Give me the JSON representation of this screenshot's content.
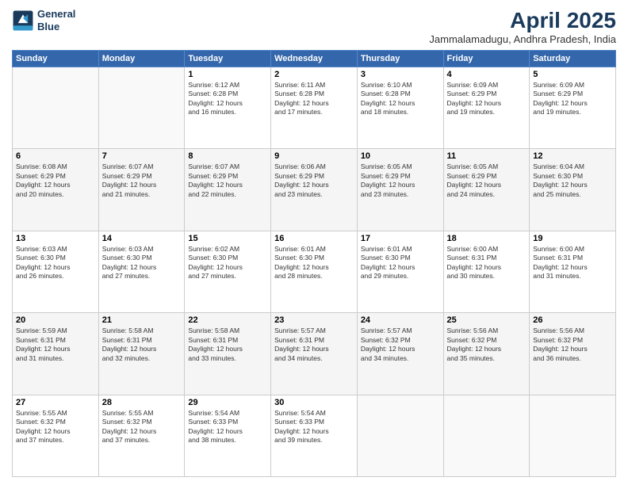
{
  "header": {
    "logo_line1": "General",
    "logo_line2": "Blue",
    "title": "April 2025",
    "subtitle": "Jammalamadugu, Andhra Pradesh, India"
  },
  "weekdays": [
    "Sunday",
    "Monday",
    "Tuesday",
    "Wednesday",
    "Thursday",
    "Friday",
    "Saturday"
  ],
  "weeks": [
    [
      {
        "day": "",
        "info": ""
      },
      {
        "day": "",
        "info": ""
      },
      {
        "day": "1",
        "info": "Sunrise: 6:12 AM\nSunset: 6:28 PM\nDaylight: 12 hours\nand 16 minutes."
      },
      {
        "day": "2",
        "info": "Sunrise: 6:11 AM\nSunset: 6:28 PM\nDaylight: 12 hours\nand 17 minutes."
      },
      {
        "day": "3",
        "info": "Sunrise: 6:10 AM\nSunset: 6:28 PM\nDaylight: 12 hours\nand 18 minutes."
      },
      {
        "day": "4",
        "info": "Sunrise: 6:09 AM\nSunset: 6:29 PM\nDaylight: 12 hours\nand 19 minutes."
      },
      {
        "day": "5",
        "info": "Sunrise: 6:09 AM\nSunset: 6:29 PM\nDaylight: 12 hours\nand 19 minutes."
      }
    ],
    [
      {
        "day": "6",
        "info": "Sunrise: 6:08 AM\nSunset: 6:29 PM\nDaylight: 12 hours\nand 20 minutes."
      },
      {
        "day": "7",
        "info": "Sunrise: 6:07 AM\nSunset: 6:29 PM\nDaylight: 12 hours\nand 21 minutes."
      },
      {
        "day": "8",
        "info": "Sunrise: 6:07 AM\nSunset: 6:29 PM\nDaylight: 12 hours\nand 22 minutes."
      },
      {
        "day": "9",
        "info": "Sunrise: 6:06 AM\nSunset: 6:29 PM\nDaylight: 12 hours\nand 23 minutes."
      },
      {
        "day": "10",
        "info": "Sunrise: 6:05 AM\nSunset: 6:29 PM\nDaylight: 12 hours\nand 23 minutes."
      },
      {
        "day": "11",
        "info": "Sunrise: 6:05 AM\nSunset: 6:29 PM\nDaylight: 12 hours\nand 24 minutes."
      },
      {
        "day": "12",
        "info": "Sunrise: 6:04 AM\nSunset: 6:30 PM\nDaylight: 12 hours\nand 25 minutes."
      }
    ],
    [
      {
        "day": "13",
        "info": "Sunrise: 6:03 AM\nSunset: 6:30 PM\nDaylight: 12 hours\nand 26 minutes."
      },
      {
        "day": "14",
        "info": "Sunrise: 6:03 AM\nSunset: 6:30 PM\nDaylight: 12 hours\nand 27 minutes."
      },
      {
        "day": "15",
        "info": "Sunrise: 6:02 AM\nSunset: 6:30 PM\nDaylight: 12 hours\nand 27 minutes."
      },
      {
        "day": "16",
        "info": "Sunrise: 6:01 AM\nSunset: 6:30 PM\nDaylight: 12 hours\nand 28 minutes."
      },
      {
        "day": "17",
        "info": "Sunrise: 6:01 AM\nSunset: 6:30 PM\nDaylight: 12 hours\nand 29 minutes."
      },
      {
        "day": "18",
        "info": "Sunrise: 6:00 AM\nSunset: 6:31 PM\nDaylight: 12 hours\nand 30 minutes."
      },
      {
        "day": "19",
        "info": "Sunrise: 6:00 AM\nSunset: 6:31 PM\nDaylight: 12 hours\nand 31 minutes."
      }
    ],
    [
      {
        "day": "20",
        "info": "Sunrise: 5:59 AM\nSunset: 6:31 PM\nDaylight: 12 hours\nand 31 minutes."
      },
      {
        "day": "21",
        "info": "Sunrise: 5:58 AM\nSunset: 6:31 PM\nDaylight: 12 hours\nand 32 minutes."
      },
      {
        "day": "22",
        "info": "Sunrise: 5:58 AM\nSunset: 6:31 PM\nDaylight: 12 hours\nand 33 minutes."
      },
      {
        "day": "23",
        "info": "Sunrise: 5:57 AM\nSunset: 6:31 PM\nDaylight: 12 hours\nand 34 minutes."
      },
      {
        "day": "24",
        "info": "Sunrise: 5:57 AM\nSunset: 6:32 PM\nDaylight: 12 hours\nand 34 minutes."
      },
      {
        "day": "25",
        "info": "Sunrise: 5:56 AM\nSunset: 6:32 PM\nDaylight: 12 hours\nand 35 minutes."
      },
      {
        "day": "26",
        "info": "Sunrise: 5:56 AM\nSunset: 6:32 PM\nDaylight: 12 hours\nand 36 minutes."
      }
    ],
    [
      {
        "day": "27",
        "info": "Sunrise: 5:55 AM\nSunset: 6:32 PM\nDaylight: 12 hours\nand 37 minutes."
      },
      {
        "day": "28",
        "info": "Sunrise: 5:55 AM\nSunset: 6:32 PM\nDaylight: 12 hours\nand 37 minutes."
      },
      {
        "day": "29",
        "info": "Sunrise: 5:54 AM\nSunset: 6:33 PM\nDaylight: 12 hours\nand 38 minutes."
      },
      {
        "day": "30",
        "info": "Sunrise: 5:54 AM\nSunset: 6:33 PM\nDaylight: 12 hours\nand 39 minutes."
      },
      {
        "day": "",
        "info": ""
      },
      {
        "day": "",
        "info": ""
      },
      {
        "day": "",
        "info": ""
      }
    ]
  ]
}
